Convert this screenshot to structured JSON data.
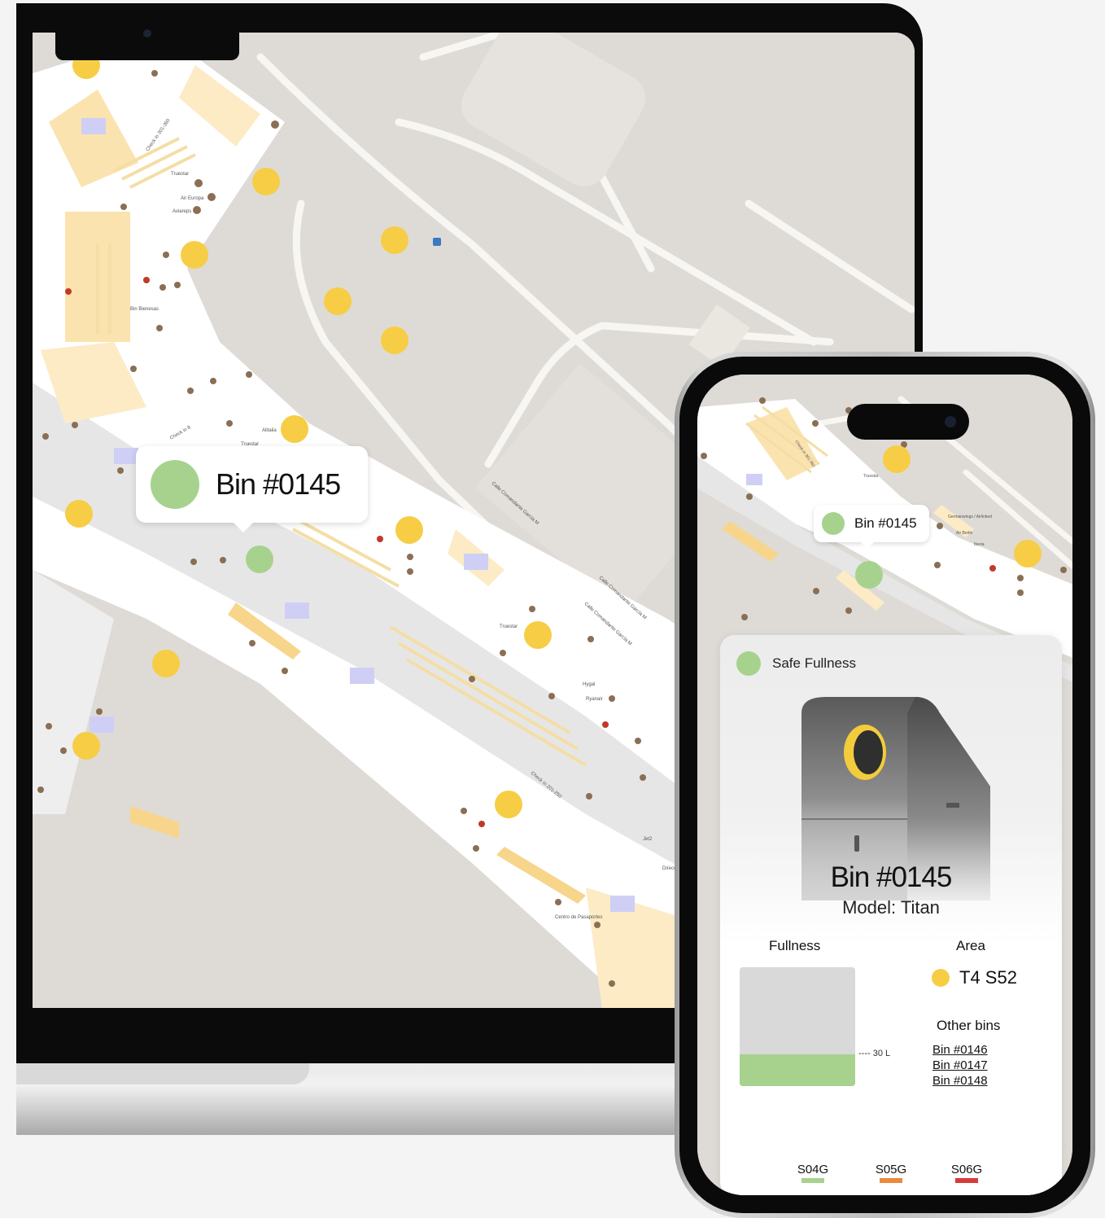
{
  "laptop": {
    "popup": {
      "label": "Bin #0145",
      "status_color": "#a7d28e"
    },
    "map": {
      "labels": {
        "check_in_1": "Check in 301-360",
        "truestar_1": "Truestar",
        "air_europa": "Air Europa",
        "aviareps": "Aviareps",
        "bin_bienesas": "Bin Bienesas",
        "alitalia": "Alitalia",
        "truestar_2": "Truestar",
        "check_in_2": "Check in 8",
        "calle_1": "Calle Comandante Garcia M",
        "calle_2": "Calle Comandante García M",
        "calle_3": "Calle Comandante García M",
        "truestar_3": "Truestar",
        "ryanair": "Ryanair",
        "hygal": "Hygal",
        "check_in_3": "Check In 201-250",
        "jet2": "Jet2",
        "direccion": "Dirección General de la Policía",
        "pasaportes": "Centro de Pasaportes"
      }
    }
  },
  "phone": {
    "popup": {
      "label": "Bin #0145"
    },
    "map": {
      "labels": {
        "check_in": "Check in 301-360",
        "truestar": "Truestar",
        "germanwings": "Germanwings / Airlinked",
        "air_berlin": "Air Berlin",
        "iberia": "Iberia"
      }
    },
    "card": {
      "status_text": "Safe Fullness",
      "status_color": "#a7d28e",
      "bin_title": "Bin #0145",
      "bin_model": "Model: Titan",
      "fullness_label": "Fullness",
      "fullness_fraction": 0.27,
      "fullness_marker": "---- 30 L",
      "area_label": "Area",
      "area_value": "T4 S52",
      "area_color": "#f6cd45",
      "other_bins_label": "Other bins",
      "other_bins": [
        "Bin #0146",
        "Bin #0147",
        "Bin #0148"
      ],
      "legend": [
        {
          "label": "S04G",
          "color": "#a7d28e"
        },
        {
          "label": "S05G",
          "color": "#e98a3c"
        },
        {
          "label": "S06G",
          "color": "#d93a3a"
        }
      ]
    }
  }
}
